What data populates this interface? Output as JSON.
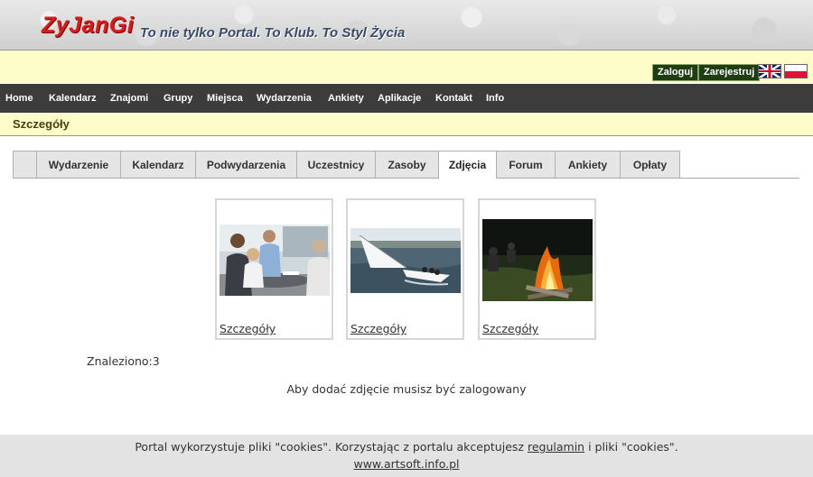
{
  "header": {
    "logo": "ZyJanGi",
    "slogan": "To nie tylko Portal. To Klub. To Styl Życia"
  },
  "auth": {
    "login": "Zaloguj",
    "register": "Zarejestruj"
  },
  "languages": [
    "flag-en-icon",
    "flag-pl-icon"
  ],
  "nav": [
    "Home",
    "Kalendarz",
    "Znajomi",
    "Grupy",
    "Miejsca",
    "Wydarzenia",
    "Ankiety",
    "Aplikacje",
    "Kontakt",
    "Info"
  ],
  "section_title": "Szczegóły",
  "tabs": [
    "",
    "Wydarzenie",
    "Kalendarz",
    "Podwydarzenia",
    "Uczestnicy",
    "Zasoby",
    "Zdjęcia",
    "Forum",
    "Ankiety",
    "Opłaty"
  ],
  "active_tab": "Zdjęcia",
  "gallery": [
    {
      "photo": "business-meeting-photo",
      "link": "Szczegóły"
    },
    {
      "photo": "sailboat-photo",
      "link": "Szczegóły"
    },
    {
      "photo": "campfire-photo",
      "link": "Szczegóły"
    }
  ],
  "found_text": "Znaleziono:3",
  "add_photo_message": "Aby dodać zdjęcie musisz być zalogowany",
  "footer": {
    "cookie_text_before": "Portal wykorzystuje pliki \"cookies\". Korzystając z portalu akceptujesz",
    "regulamin_link": "regulamin",
    "cookie_text_after": "i pliki \"cookies\".",
    "site_link": "www.artsoft.info.pl"
  },
  "colors": {
    "accent_yellow": "#fdfdc9",
    "nav_bg": "#3c3c3c",
    "button_green": "#1f3d12",
    "logo_red": "#d21e1e"
  }
}
